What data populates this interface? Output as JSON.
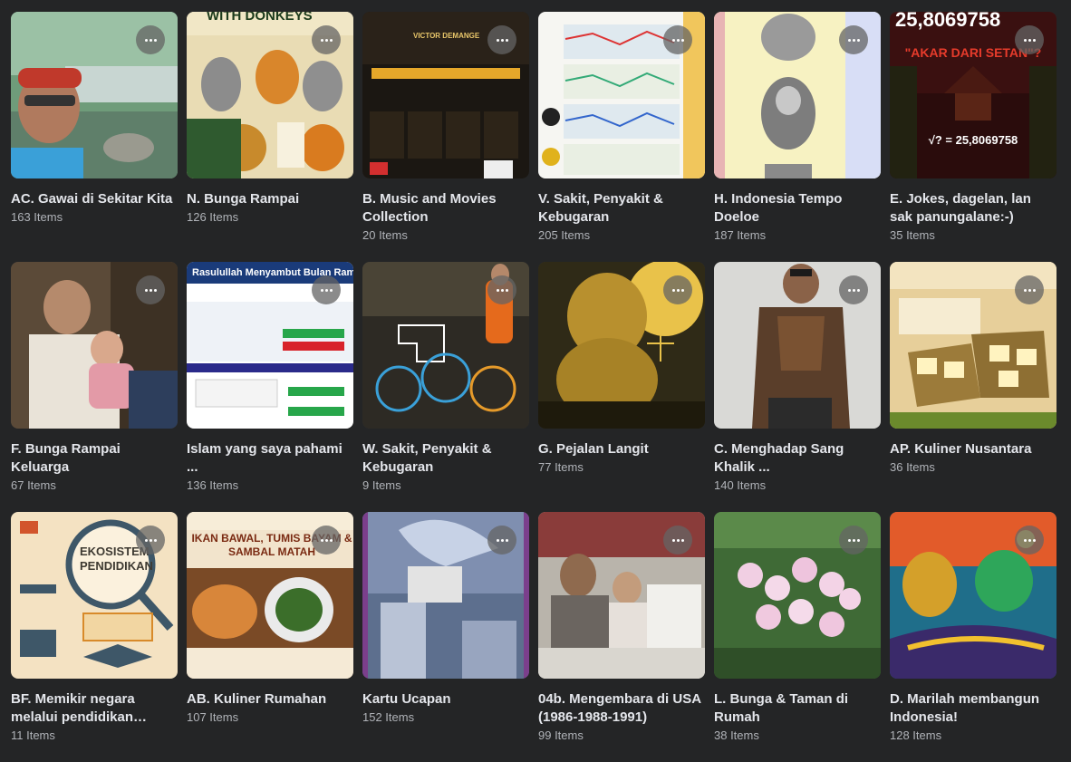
{
  "albums": [
    {
      "title": "AC. Gawai di Sekitar Kita",
      "count": "163 Items"
    },
    {
      "title": "N. Bunga Rampai",
      "count": "126 Items",
      "overlay": "WITH DONKEYS"
    },
    {
      "title": "B. Music and Movies Collection",
      "count": "20 Items",
      "overlay": "VICTOR DEMANGE"
    },
    {
      "title": "V. Sakit, Penyakit & Kebugaran",
      "count": "205 Items"
    },
    {
      "title": "H. Indonesia Tempo Doeloe",
      "count": "187 Items"
    },
    {
      "title": "E. Jokes, dagelan, lan sak panungalane:-)",
      "count": "35 Items",
      "overlay": "25,8069758"
    },
    {
      "title": "F. Bunga Rampai Keluarga",
      "count": "67 Items"
    },
    {
      "title": "Islam yang saya pahami ...",
      "count": "136 Items",
      "overlay": "Rasulullah Menyambut Bulan Ramadhan"
    },
    {
      "title": "W. Sakit, Penyakit & Kebugaran",
      "count": "9 Items"
    },
    {
      "title": "G. Pejalan Langit",
      "count": "77 Items"
    },
    {
      "title": "C. Menghadap Sang Khalik ...",
      "count": "140 Items"
    },
    {
      "title": "AP. Kuliner Nusantara",
      "count": "36 Items"
    },
    {
      "title": "BF. Memikir negara melalui pendidikan nasional...",
      "count": "11 Items",
      "overlay": "EKOSISTEM PENDIDIKAN"
    },
    {
      "title": "AB. Kuliner Rumahan",
      "count": "107 Items",
      "overlay": "IKAN BAWAL, TUMIS BAYAM & SAMBAL MATAH"
    },
    {
      "title": "Kartu Ucapan",
      "count": "152 Items"
    },
    {
      "title": "04b. Mengembara di USA (1986-1988-1991)",
      "count": "99 Items"
    },
    {
      "title": "L. Bunga & Taman di Rumah",
      "count": "38 Items"
    },
    {
      "title": "D. Marilah membangun Indonesia!",
      "count": "128 Items"
    }
  ],
  "colors": {
    "background": "#242526",
    "title_text": "#e4e6eb",
    "count_text": "#b0b3b8",
    "more_button_bg": "#646464"
  },
  "icons": {
    "more": "more-horizontal-icon"
  }
}
